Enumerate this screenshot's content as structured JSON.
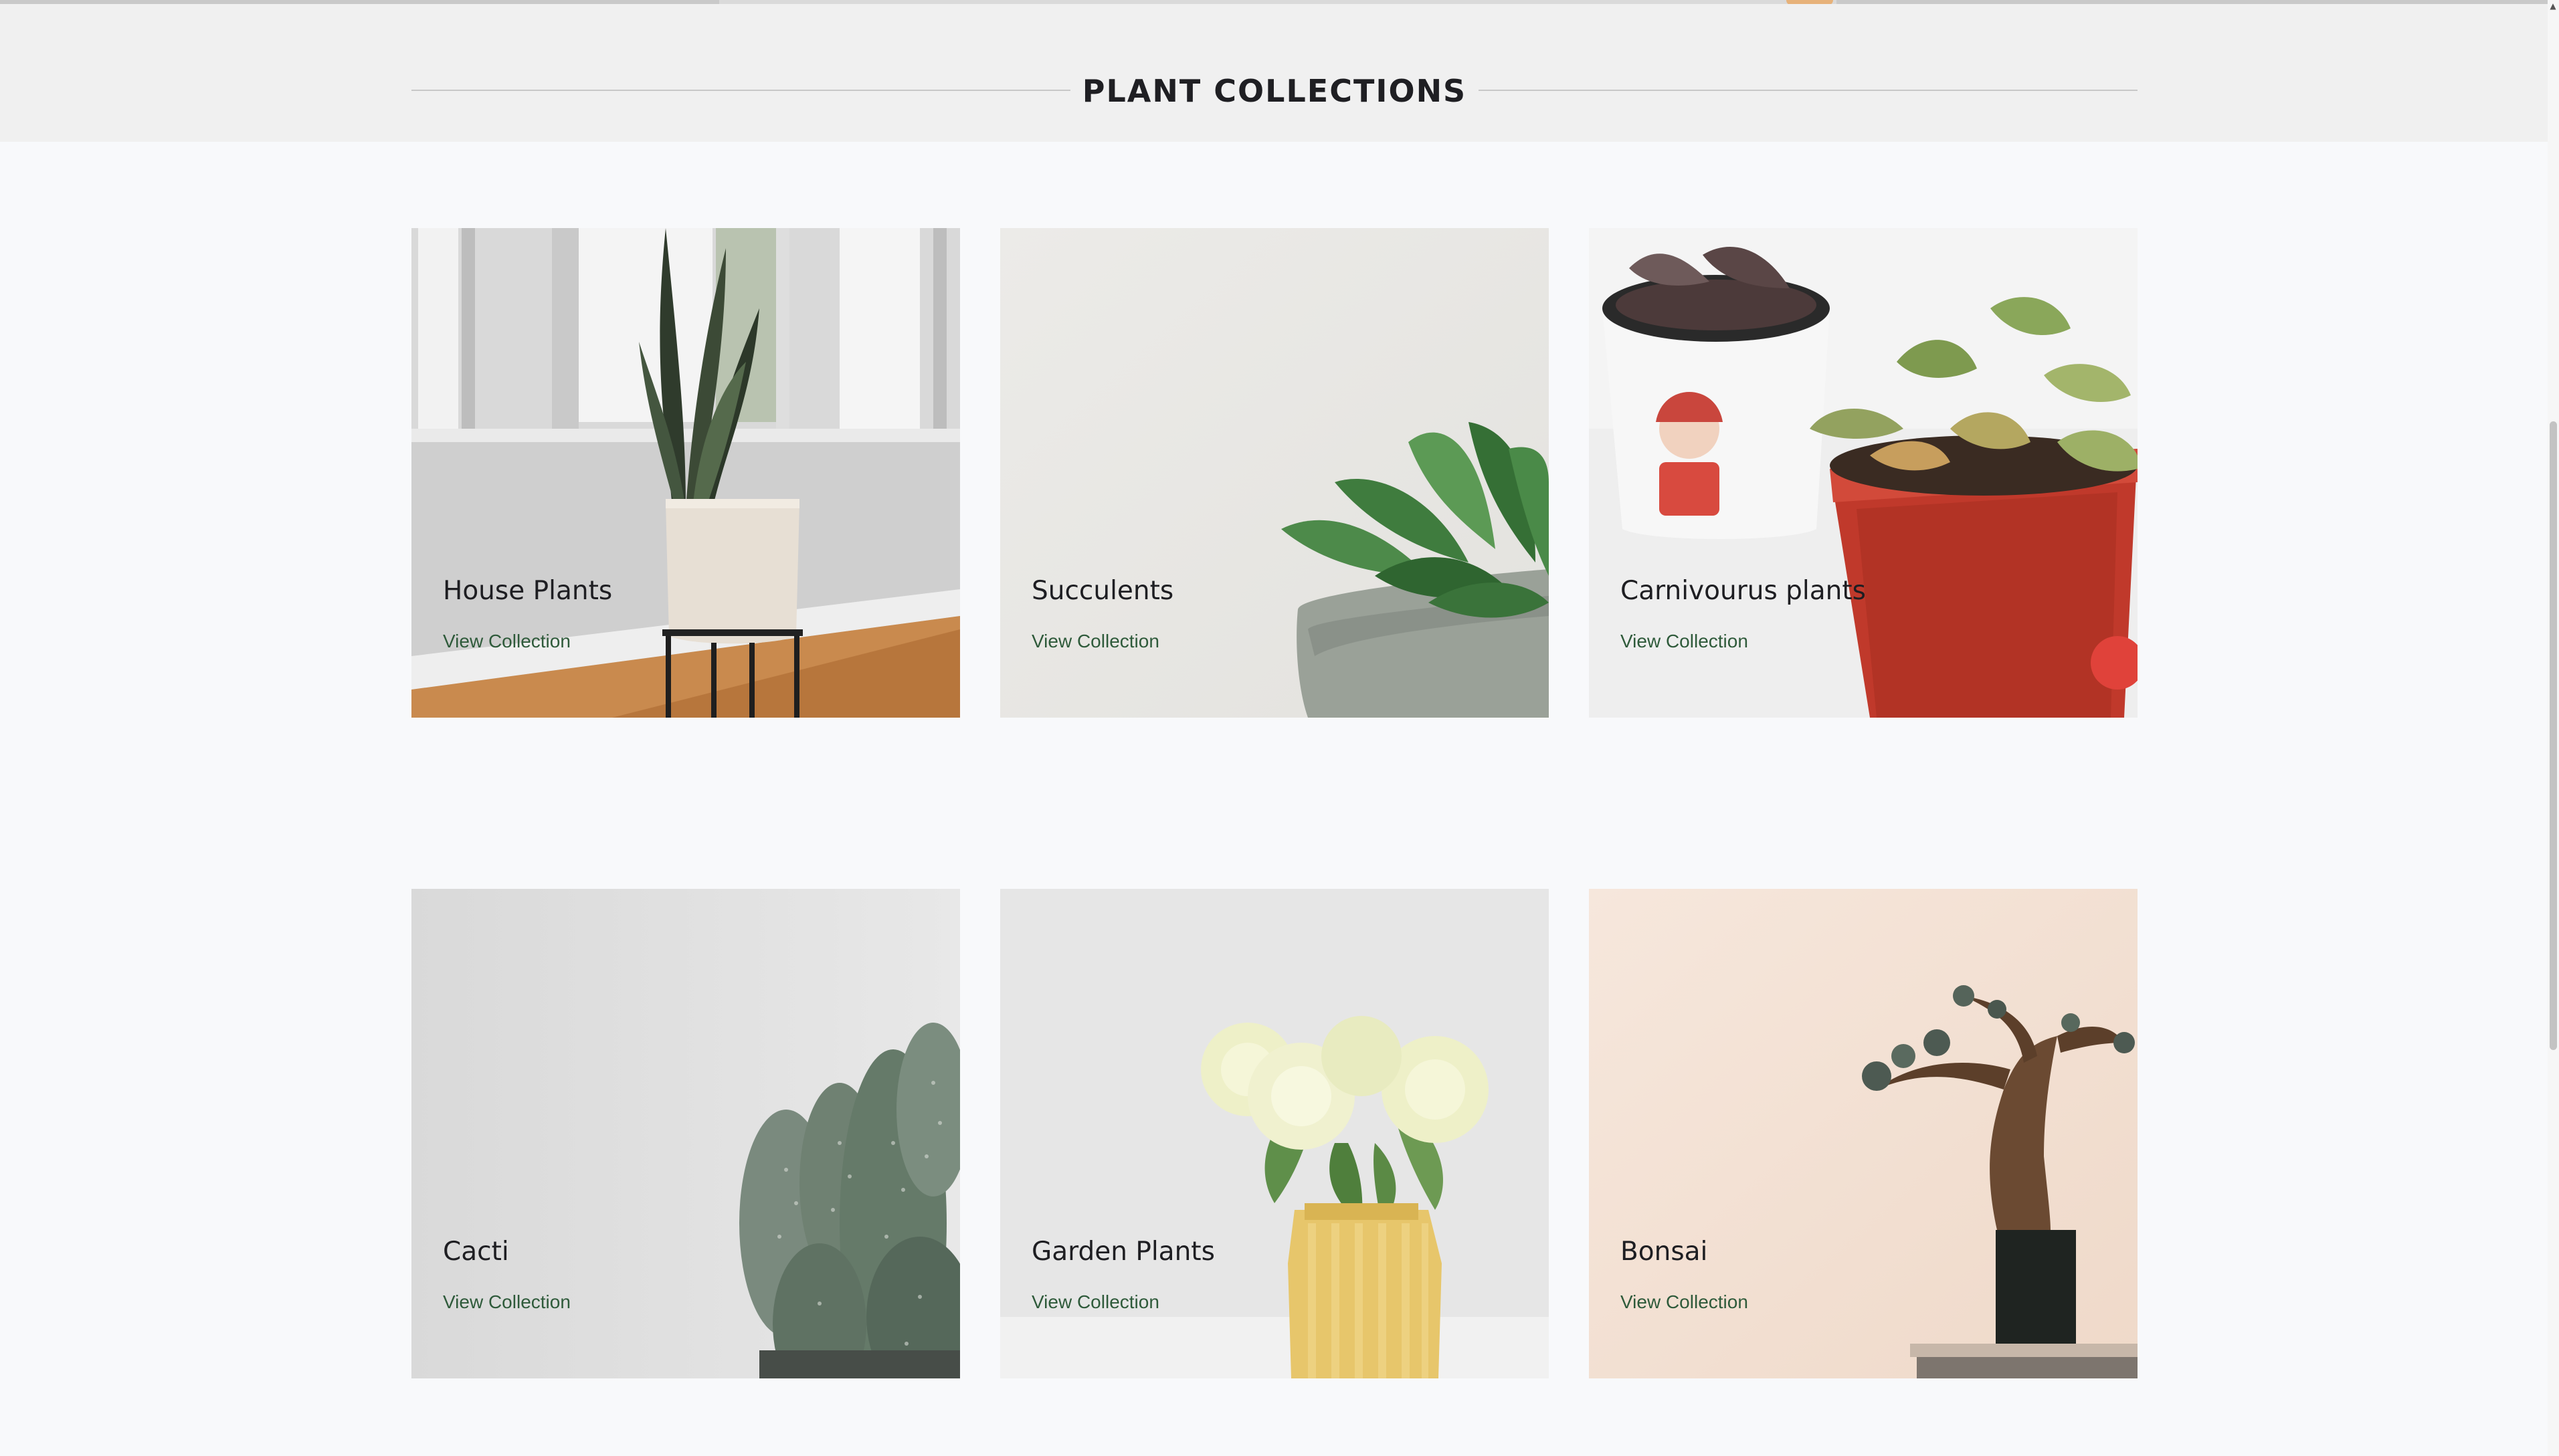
{
  "section": {
    "title": "PLANT COLLECTIONS"
  },
  "collections": [
    {
      "name": "House Plants",
      "link": "View Collection",
      "image": "snake-plant-in-pot-on-stand"
    },
    {
      "name": "Succulents",
      "link": "View Collection",
      "image": "succulent-in-concrete-pot"
    },
    {
      "name": "Carnivourus plants",
      "link": "View Collection",
      "image": "venus-flytrap-in-red-pot"
    },
    {
      "name": "Cacti",
      "link": "View Collection",
      "image": "bunny-ear-cactus"
    },
    {
      "name": "Garden Plants",
      "link": "View Collection",
      "image": "white-roses-in-gold-vase"
    },
    {
      "name": "Bonsai",
      "link": "View Collection",
      "image": "bonsai-tree-on-stand"
    }
  ],
  "colors": {
    "link": "#2e5a3a",
    "title": "#1e1e22",
    "header_band": "#f0f0f0",
    "page_background": "#f8f9fb"
  }
}
